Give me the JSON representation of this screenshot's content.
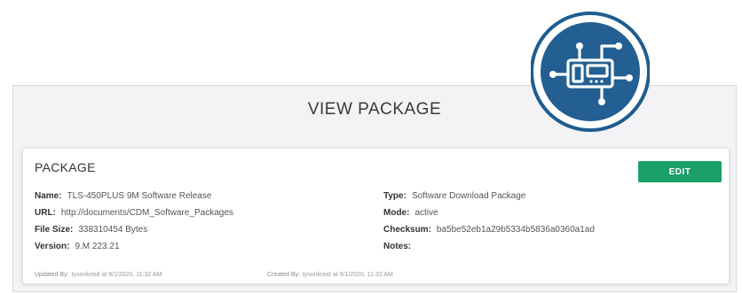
{
  "view_title": "VIEW PACKAGE",
  "card": {
    "title": "PACKAGE",
    "edit_label": "EDIT",
    "fields": {
      "name": {
        "label": "Name:",
        "value": "TLS-450PLUS 9M Software Release"
      },
      "url": {
        "label": "URL:",
        "value": "http://documents/CDM_Software_Packages"
      },
      "file_size": {
        "label": "File Size:",
        "value": "338310454 Bytes"
      },
      "version": {
        "label": "Version:",
        "value": "9.M 223.21"
      },
      "type": {
        "label": "Type:",
        "value": "Software Download Package"
      },
      "mode": {
        "label": "Mode:",
        "value": "active"
      },
      "checksum": {
        "label": "Checksum:",
        "value": "ba5be52eb1a29b5334b5836a0360a1ad"
      },
      "notes": {
        "label": "Notes:",
        "value": ""
      }
    },
    "updated": {
      "label": "Updated By:",
      "value": "tysonkreid at 9/1/2020, 11:32 AM"
    },
    "created": {
      "label": "Created By:",
      "value": "tysonkreid at 9/1/2020, 11:32 AM"
    }
  },
  "colors": {
    "edit_button": "#1aa068",
    "logo_ring": "#1e5d8f",
    "logo_inner": "#235f92",
    "panel_bg": "#f3f3f6"
  },
  "icons": {
    "logo": "circuit-device-icon"
  }
}
